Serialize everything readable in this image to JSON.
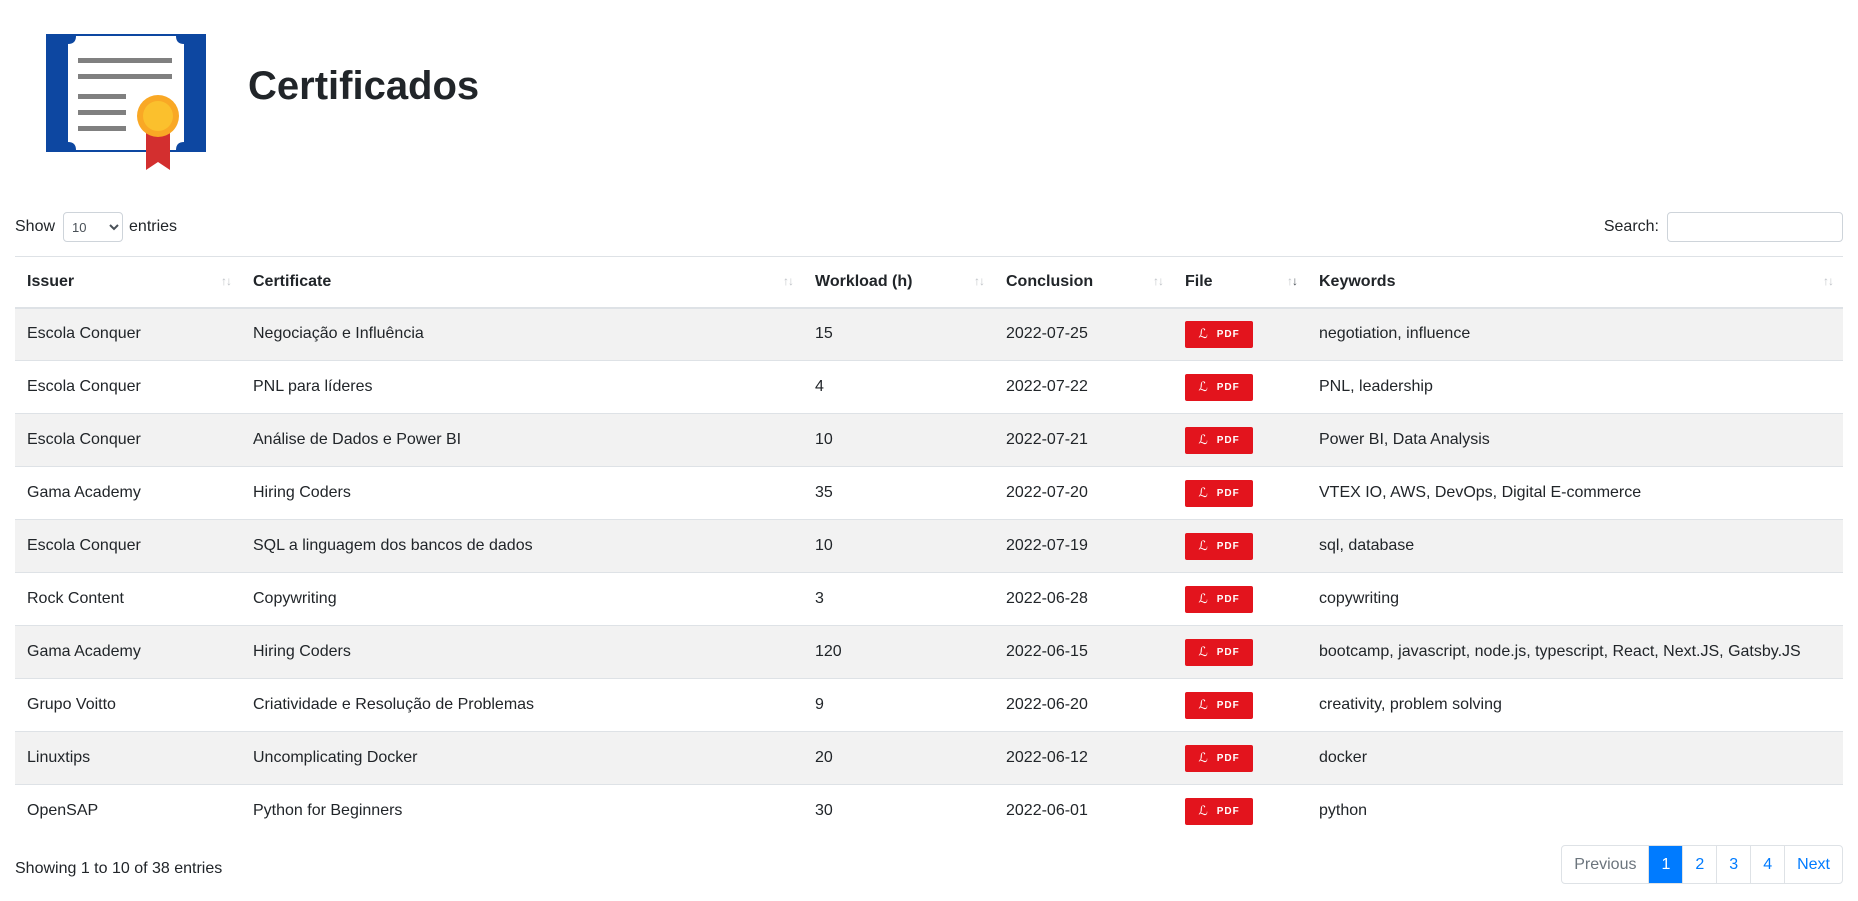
{
  "header": {
    "title": "Certificados",
    "logo_icon": "certificate-icon"
  },
  "controls": {
    "show_label": "Show",
    "length_value": "10",
    "entries_label": "entries",
    "search_label": "Search:",
    "search_value": ""
  },
  "table": {
    "columns": [
      "Issuer",
      "Certificate",
      "Workload (h)",
      "Conclusion",
      "File",
      "Keywords"
    ],
    "pdf_label": "PDF",
    "rows": [
      {
        "issuer": "Escola Conquer",
        "certificate": "Negociação e Influência",
        "workload": "15",
        "conclusion": "2022-07-25",
        "keywords": "negotiation, influence"
      },
      {
        "issuer": "Escola Conquer",
        "certificate": "PNL para líderes",
        "workload": "4",
        "conclusion": "2022-07-22",
        "keywords": "PNL, leadership"
      },
      {
        "issuer": "Escola Conquer",
        "certificate": "Análise de Dados e Power BI",
        "workload": "10",
        "conclusion": "2022-07-21",
        "keywords": "Power BI, Data Analysis"
      },
      {
        "issuer": "Gama Academy",
        "certificate": "Hiring Coders",
        "workload": "35",
        "conclusion": "2022-07-20",
        "keywords": "VTEX IO, AWS, DevOps, Digital E-commerce"
      },
      {
        "issuer": "Escola Conquer",
        "certificate": "SQL a linguagem dos bancos de dados",
        "workload": "10",
        "conclusion": "2022-07-19",
        "keywords": "sql, database"
      },
      {
        "issuer": "Rock Content",
        "certificate": "Copywriting",
        "workload": "3",
        "conclusion": "2022-06-28",
        "keywords": "copywriting"
      },
      {
        "issuer": "Gama Academy",
        "certificate": "Hiring Coders",
        "workload": "120",
        "conclusion": "2022-06-15",
        "keywords": "bootcamp, javascript, node.js, typescript, React, Next.JS, Gatsby.JS"
      },
      {
        "issuer": "Grupo Voitto",
        "certificate": "Criatividade e Resolução de Problemas",
        "workload": "9",
        "conclusion": "2022-06-20",
        "keywords": "creativity, problem solving"
      },
      {
        "issuer": "Linuxtips",
        "certificate": "Uncomplicating Docker",
        "workload": "20",
        "conclusion": "2022-06-12",
        "keywords": "docker"
      },
      {
        "issuer": "OpenSAP",
        "certificate": "Python for Beginners",
        "workload": "30",
        "conclusion": "2022-06-01",
        "keywords": "python"
      }
    ]
  },
  "footer": {
    "info": "Showing 1 to 10 of 38 entries",
    "pagination": {
      "previous": "Previous",
      "pages": [
        "1",
        "2",
        "3",
        "4"
      ],
      "next": "Next",
      "active": "1"
    }
  },
  "colors": {
    "pdf_button": "#e3141d",
    "accent": "#007bff",
    "logo_blue": "#0d47a1",
    "seal_orange": "#f9a825",
    "ribbon_red": "#d32f2f"
  }
}
